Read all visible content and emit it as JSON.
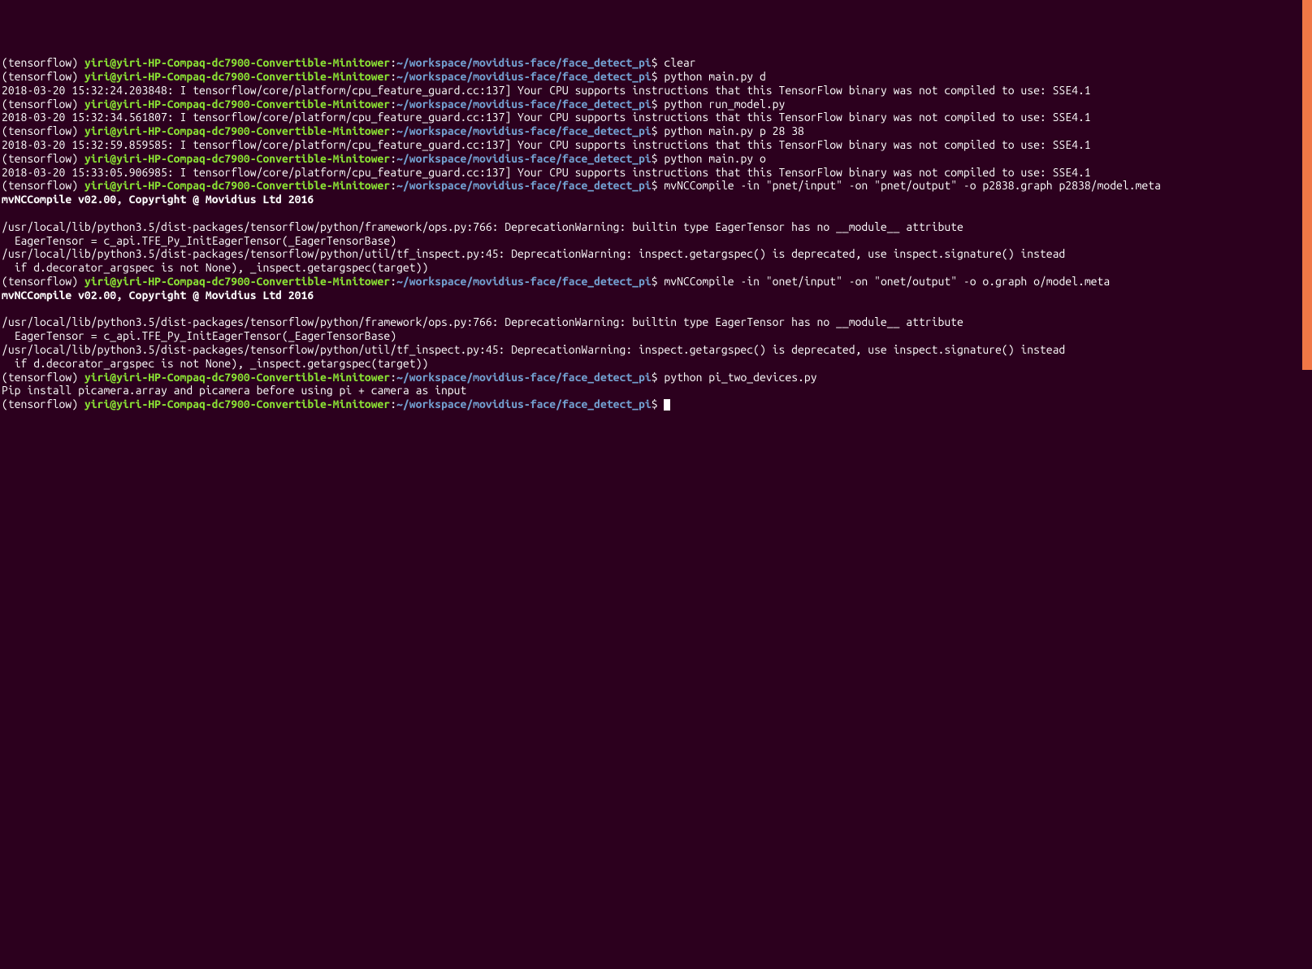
{
  "prompt": {
    "env": "(tensorflow) ",
    "userhost": "yiri@yiri-HP-Compaq-dc7900-Convertible-Minitower",
    "colon": ":",
    "path": "~/workspace/movidius-face/face_detect_pi",
    "dollar": "$ "
  },
  "lines": [
    {
      "type": "prompt",
      "cmd": "clear"
    },
    {
      "type": "prompt",
      "cmd": "python main.py d"
    },
    {
      "type": "out",
      "text": "2018-03-20 15:32:24.203848: I tensorflow/core/platform/cpu_feature_guard.cc:137] Your CPU supports instructions that this TensorFlow binary was not compiled to use: SSE4.1"
    },
    {
      "type": "prompt",
      "cmd": "python run_model.py"
    },
    {
      "type": "out",
      "text": "2018-03-20 15:32:34.561807: I tensorflow/core/platform/cpu_feature_guard.cc:137] Your CPU supports instructions that this TensorFlow binary was not compiled to use: SSE4.1"
    },
    {
      "type": "prompt",
      "cmd": "python main.py p 28 38"
    },
    {
      "type": "out",
      "text": "2018-03-20 15:32:59.859585: I tensorflow/core/platform/cpu_feature_guard.cc:137] Your CPU supports instructions that this TensorFlow binary was not compiled to use: SSE4.1"
    },
    {
      "type": "prompt",
      "cmd": "python main.py o"
    },
    {
      "type": "out",
      "text": "2018-03-20 15:33:05.906985: I tensorflow/core/platform/cpu_feature_guard.cc:137] Your CPU supports instructions that this TensorFlow binary was not compiled to use: SSE4.1"
    },
    {
      "type": "prompt",
      "cmd": "mvNCCompile -in \"pnet/input\" -on \"pnet/output\" -o p2838.graph p2838/model.meta"
    },
    {
      "type": "bold",
      "text": "mvNCCompile v02.00, Copyright @ Movidius Ltd 2016"
    },
    {
      "type": "blank",
      "text": ""
    },
    {
      "type": "out",
      "text": "/usr/local/lib/python3.5/dist-packages/tensorflow/python/framework/ops.py:766: DeprecationWarning: builtin type EagerTensor has no __module__ attribute"
    },
    {
      "type": "out",
      "text": "  EagerTensor = c_api.TFE_Py_InitEagerTensor(_EagerTensorBase)"
    },
    {
      "type": "out",
      "text": "/usr/local/lib/python3.5/dist-packages/tensorflow/python/util/tf_inspect.py:45: DeprecationWarning: inspect.getargspec() is deprecated, use inspect.signature() instead"
    },
    {
      "type": "out",
      "text": "  if d.decorator_argspec is not None), _inspect.getargspec(target))"
    },
    {
      "type": "prompt",
      "cmd": "mvNCCompile -in \"onet/input\" -on \"onet/output\" -o o.graph o/model.meta"
    },
    {
      "type": "bold",
      "text": "mvNCCompile v02.00, Copyright @ Movidius Ltd 2016"
    },
    {
      "type": "blank",
      "text": ""
    },
    {
      "type": "out",
      "text": "/usr/local/lib/python3.5/dist-packages/tensorflow/python/framework/ops.py:766: DeprecationWarning: builtin type EagerTensor has no __module__ attribute"
    },
    {
      "type": "out",
      "text": "  EagerTensor = c_api.TFE_Py_InitEagerTensor(_EagerTensorBase)"
    },
    {
      "type": "out",
      "text": "/usr/local/lib/python3.5/dist-packages/tensorflow/python/util/tf_inspect.py:45: DeprecationWarning: inspect.getargspec() is deprecated, use inspect.signature() instead"
    },
    {
      "type": "out",
      "text": "  if d.decorator_argspec is not None), _inspect.getargspec(target))"
    },
    {
      "type": "prompt",
      "cmd": "python pi_two_devices.py"
    },
    {
      "type": "out",
      "text": "Pip install picamera.array and picamera before using pi + camera as input"
    },
    {
      "type": "prompt-cursor",
      "cmd": ""
    }
  ]
}
